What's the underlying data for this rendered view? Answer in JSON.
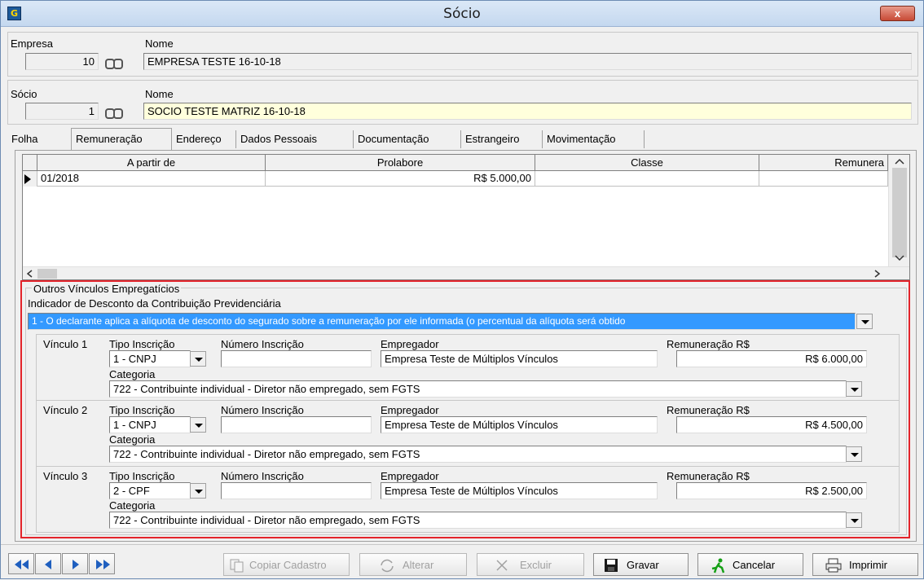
{
  "window": {
    "title": "Sócio",
    "close_label": "x"
  },
  "empresa": {
    "label_code": "Empresa",
    "label_name": "Nome",
    "code": "10",
    "name": "EMPRESA TESTE 16-10-18"
  },
  "socio": {
    "label_code": "Sócio",
    "label_name": "Nome",
    "code": "1",
    "name": "SOCIO TESTE MATRIZ 16-10-18"
  },
  "tabs": [
    "Folha",
    "Remuneração",
    "Endereço",
    "Dados Pessoais",
    "Documentação",
    "Estrangeiro",
    "Movimentação"
  ],
  "active_tab": "Remuneração",
  "grid": {
    "columns": [
      "A partir de",
      "Prolabore",
      "Classe",
      "Remunera"
    ],
    "rows": [
      {
        "a_partir_de": "01/2018",
        "prolabore": "R$ 5.000,00",
        "classe": "",
        "remuneracao": ""
      }
    ]
  },
  "outros": {
    "title": "Outros Vínculos Empregatícios",
    "indicador_label": "Indicador de Desconto da Contribuição Previdenciária",
    "indicador_value": "1 - O declarante aplica a alíquota de desconto do segurado sobre a remuneração por ele informada (o percentual da alíquota será obtido",
    "labels": {
      "tipo": "Tipo Inscrição",
      "numero": "Número Inscrição",
      "empregador": "Empregador",
      "remuneracao": "Remuneração R$",
      "categoria": "Categoria"
    },
    "vinculos": [
      {
        "name": "Vínculo 1",
        "tipo": "1 - CNPJ",
        "numero": "",
        "empregador": "Empresa Teste de Múltiplos Vínculos",
        "remuneracao": "R$ 6.000,00",
        "categoria": "722 - Contribuinte individual - Diretor não empregado, sem FGTS"
      },
      {
        "name": "Vínculo 2",
        "tipo": "1 - CNPJ",
        "numero": "",
        "empregador": "Empresa Teste de Múltiplos Vínculos",
        "remuneracao": "R$ 4.500,00",
        "categoria": "722 - Contribuinte individual - Diretor não empregado, sem FGTS"
      },
      {
        "name": "Vínculo 3",
        "tipo": "2 - CPF",
        "numero": "",
        "empregador": "Empresa Teste de Múltiplos Vínculos",
        "remuneracao": "R$ 2.500,00",
        "categoria": "722 - Contribuinte individual - Diretor não empregado, sem FGTS"
      }
    ]
  },
  "toolbar": {
    "copiar": "Copiar Cadastro",
    "alterar": "Alterar",
    "excluir": "Excluir",
    "gravar": "Gravar",
    "cancelar": "Cancelar",
    "imprimir": "Imprimir"
  },
  "colors": {
    "highlight": "#3399ff",
    "red_box": "#e3242b",
    "yellow_field": "#ffffdc"
  }
}
